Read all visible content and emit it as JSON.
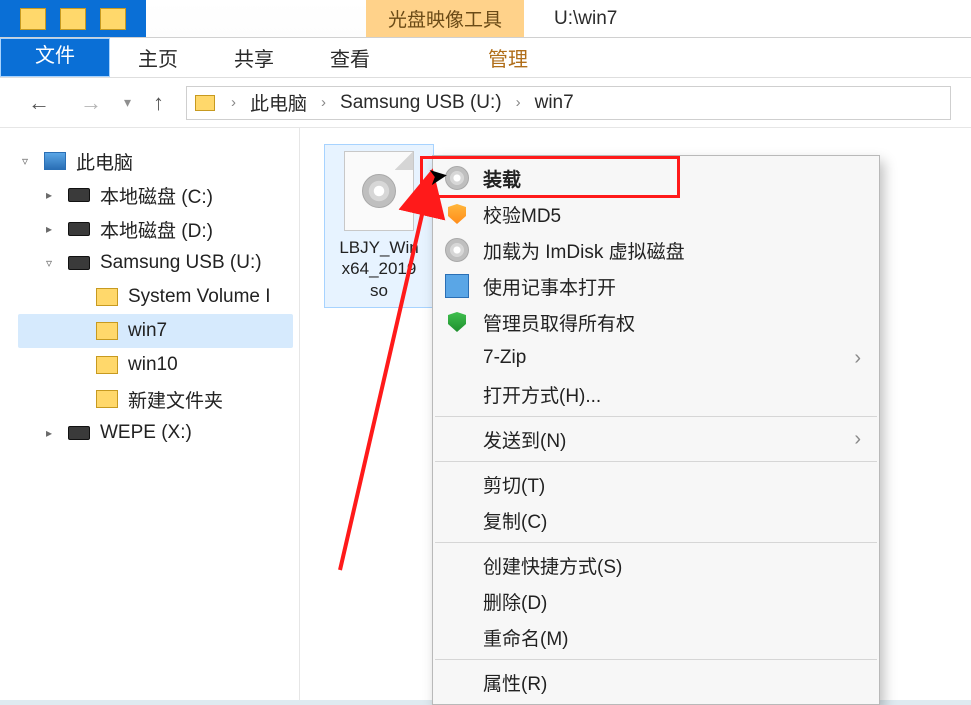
{
  "titlebar": {
    "context_tool": "光盘映像工具",
    "title": "U:\\win7"
  },
  "ribbon": {
    "file": "文件",
    "home": "主页",
    "share": "共享",
    "view": "查看",
    "manage": "管理"
  },
  "nav": {
    "back": "←",
    "forward": "→",
    "up": "↑"
  },
  "breadcrumb": {
    "segments": [
      "此电脑",
      "Samsung USB (U:)",
      "win7"
    ]
  },
  "tree": {
    "root": "此电脑",
    "items": [
      {
        "label": "本地磁盘 (C:)",
        "kind": "drive"
      },
      {
        "label": "本地磁盘 (D:)",
        "kind": "drive"
      },
      {
        "label": "Samsung USB (U:)",
        "kind": "drive",
        "expanded": true,
        "children": [
          {
            "label": "System Volume I",
            "kind": "folder"
          },
          {
            "label": "win7",
            "kind": "folder",
            "selected": true
          },
          {
            "label": "win10",
            "kind": "folder"
          },
          {
            "label": "新建文件夹",
            "kind": "folder"
          }
        ]
      },
      {
        "label": "WEPE (X:)",
        "kind": "drive"
      }
    ]
  },
  "file": {
    "name_line1": "LBJY_Win",
    "name_line2": "x64_2019",
    "name_line3": "so"
  },
  "context_menu": {
    "mount": "装载",
    "md5": "校验MD5",
    "imdisk": "加载为 ImDisk 虚拟磁盘",
    "notepad": "使用记事本打开",
    "admin_own": "管理员取得所有权",
    "sevenzip": "7-Zip",
    "open_with": "打开方式(H)...",
    "send_to": "发送到(N)",
    "cut": "剪切(T)",
    "copy": "复制(C)",
    "shortcut": "创建快捷方式(S)",
    "delete": "删除(D)",
    "rename": "重命名(M)",
    "properties": "属性(R)"
  }
}
